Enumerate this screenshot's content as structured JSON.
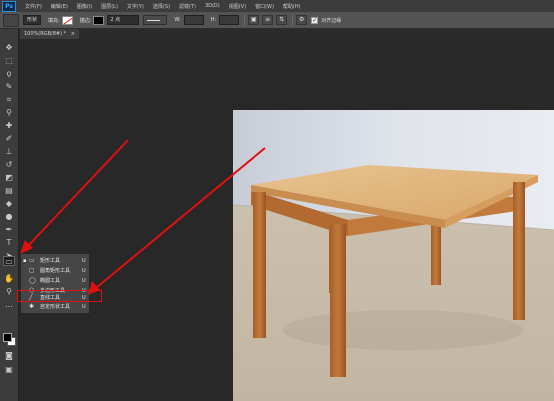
{
  "menu": {
    "logo": "Ps",
    "items": [
      "文件(F)",
      "编辑(E)",
      "图像(I)",
      "图层(L)",
      "文字(Y)",
      "选择(S)",
      "滤镜(T)",
      "3D(D)",
      "视图(V)",
      "窗口(W)",
      "帮助(H)"
    ]
  },
  "options": {
    "mode": "形状",
    "fill_label": "填充:",
    "stroke_label": "描边:",
    "stroke_width": "2 点",
    "w_label": "W:",
    "h_label": "H:",
    "align_edges_label": "对齐边缘",
    "align_checked": "✓"
  },
  "document": {
    "tab_title": "100%(RGB/8#) *",
    "close": "×"
  },
  "flyout": {
    "marker": "▪",
    "items": [
      {
        "label": "矩形工具",
        "key": "U",
        "icon": "rectangle-icon",
        "glyph": "▭"
      },
      {
        "label": "圆角矩形工具",
        "key": "U",
        "icon": "rounded-rectangle-icon",
        "glyph": "▢"
      },
      {
        "label": "椭圆工具",
        "key": "U",
        "icon": "ellipse-icon",
        "glyph": "◯"
      },
      {
        "label": "多边形工具",
        "key": "U",
        "icon": "polygon-icon",
        "glyph": "⬡"
      },
      {
        "label": "直线工具",
        "key": "U",
        "icon": "line-icon",
        "glyph": "╱"
      },
      {
        "label": "自定形状工具",
        "key": "U",
        "icon": "custom-shape-icon",
        "glyph": "✱"
      }
    ]
  },
  "colors": {
    "annotation": "#e01010",
    "menubar": "#3c3c3c",
    "optionsbar": "#535353",
    "canvas": "#282828"
  }
}
